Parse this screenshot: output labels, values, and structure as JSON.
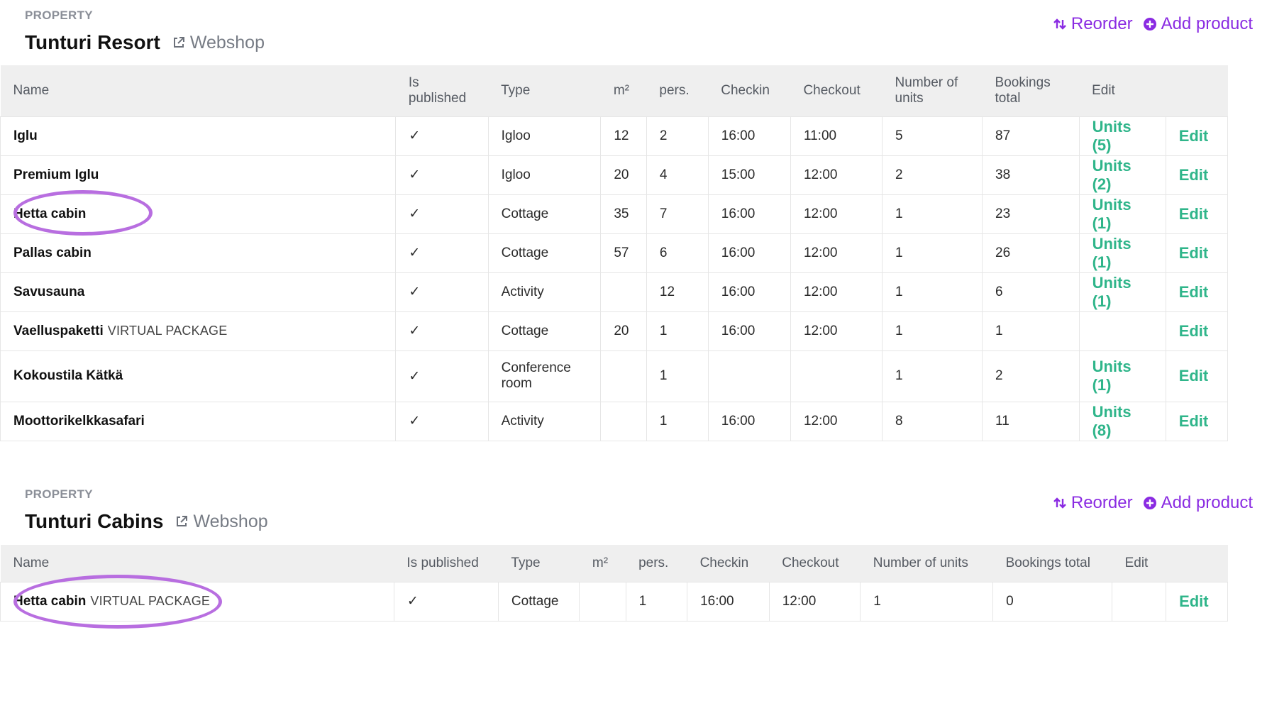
{
  "sections": [
    {
      "property_label": "PROPERTY",
      "property_name": "Tunturi Resort",
      "webshop_label": "Webshop",
      "reorder_label": "Reorder",
      "add_product_label": "Add product",
      "headers": [
        "Name",
        "Is published",
        "Type",
        "m²",
        "pers.",
        "Checkin",
        "Checkout",
        "Number of units",
        "Bookings total",
        "Edit"
      ],
      "rows": [
        {
          "name": "Iglu",
          "tag": "",
          "published": "✓",
          "type": "Igloo",
          "m2": "12",
          "pers": "2",
          "checkin": "16:00",
          "checkout": "11:00",
          "units": "5",
          "bookings": "87",
          "units_link": "Units (5)",
          "edit": "Edit"
        },
        {
          "name": "Premium Iglu",
          "tag": "",
          "published": "✓",
          "type": "Igloo",
          "m2": "20",
          "pers": "4",
          "checkin": "15:00",
          "checkout": "12:00",
          "units": "2",
          "bookings": "38",
          "units_link": "Units (2)",
          "edit": "Edit"
        },
        {
          "name": "Hetta cabin",
          "tag": "",
          "published": "✓",
          "type": "Cottage",
          "m2": "35",
          "pers": "7",
          "checkin": "16:00",
          "checkout": "12:00",
          "units": "1",
          "bookings": "23",
          "units_link": "Units (1)",
          "edit": "Edit"
        },
        {
          "name": "Pallas cabin",
          "tag": "",
          "published": "✓",
          "type": "Cottage",
          "m2": "57",
          "pers": "6",
          "checkin": "16:00",
          "checkout": "12:00",
          "units": "1",
          "bookings": "26",
          "units_link": "Units (1)",
          "edit": "Edit"
        },
        {
          "name": "Savusauna",
          "tag": "",
          "published": "✓",
          "type": "Activity",
          "m2": "",
          "pers": "12",
          "checkin": "16:00",
          "checkout": "12:00",
          "units": "1",
          "bookings": "6",
          "units_link": "Units (1)",
          "edit": "Edit"
        },
        {
          "name": "Vaelluspaketti",
          "tag": "VIRTUAL PACKAGE",
          "published": "✓",
          "type": "Cottage",
          "m2": "20",
          "pers": "1",
          "checkin": "16:00",
          "checkout": "12:00",
          "units": "1",
          "bookings": "1",
          "units_link": "",
          "edit": "Edit"
        },
        {
          "name": "Kokoustila Kätkä",
          "tag": "",
          "published": "✓",
          "type": "Conference room",
          "m2": "",
          "pers": "1",
          "checkin": "",
          "checkout": "",
          "units": "1",
          "bookings": "2",
          "units_link": "Units (1)",
          "edit": "Edit"
        },
        {
          "name": "Moottorikelkkasafari",
          "tag": "",
          "published": "✓",
          "type": "Activity",
          "m2": "",
          "pers": "1",
          "checkin": "16:00",
          "checkout": "12:00",
          "units": "8",
          "bookings": "11",
          "units_link": "Units (8)",
          "edit": "Edit"
        }
      ]
    },
    {
      "property_label": "PROPERTY",
      "property_name": "Tunturi Cabins",
      "webshop_label": "Webshop",
      "reorder_label": "Reorder",
      "add_product_label": "Add product",
      "headers": [
        "Name",
        "Is published",
        "Type",
        "m²",
        "pers.",
        "Checkin",
        "Checkout",
        "Number of units",
        "Bookings total",
        "Edit"
      ],
      "rows": [
        {
          "name": "Hetta cabin",
          "tag": "VIRTUAL PACKAGE",
          "published": "✓",
          "type": "Cottage",
          "m2": "",
          "pers": "1",
          "checkin": "16:00",
          "checkout": "12:00",
          "units": "1",
          "bookings": "0",
          "units_link": "",
          "edit": "Edit"
        }
      ]
    }
  ],
  "colors": {
    "accent_purple": "#8a2be2",
    "link_green": "#2fb58a",
    "highlight_circle": "#b86ee0",
    "header_bg": "#efefef"
  },
  "icons": [
    "external-link-icon",
    "reorder-icon",
    "plus-circle-icon"
  ]
}
